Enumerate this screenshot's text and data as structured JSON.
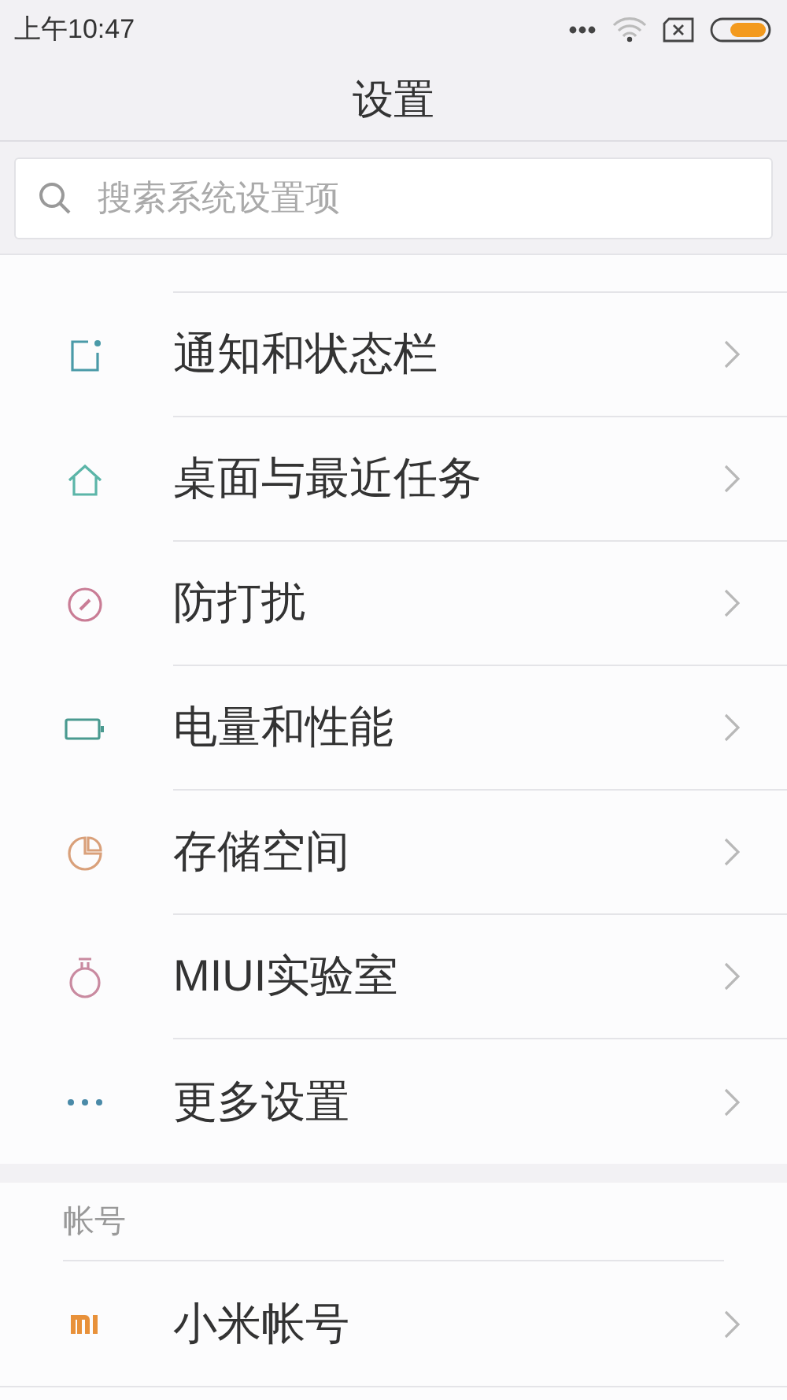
{
  "status_bar": {
    "time": "上午10:47"
  },
  "header": {
    "title": "设置"
  },
  "search": {
    "placeholder": "搜索系统设置项"
  },
  "items": [
    {
      "label": "通知和状态栏"
    },
    {
      "label": "桌面与最近任务"
    },
    {
      "label": "防打扰"
    },
    {
      "label": "电量和性能"
    },
    {
      "label": "存储空间"
    },
    {
      "label": "MIUI实验室"
    },
    {
      "label": "更多设置"
    }
  ],
  "account_section": {
    "title": "帐号",
    "items": [
      {
        "label": "小米帐号"
      }
    ]
  }
}
